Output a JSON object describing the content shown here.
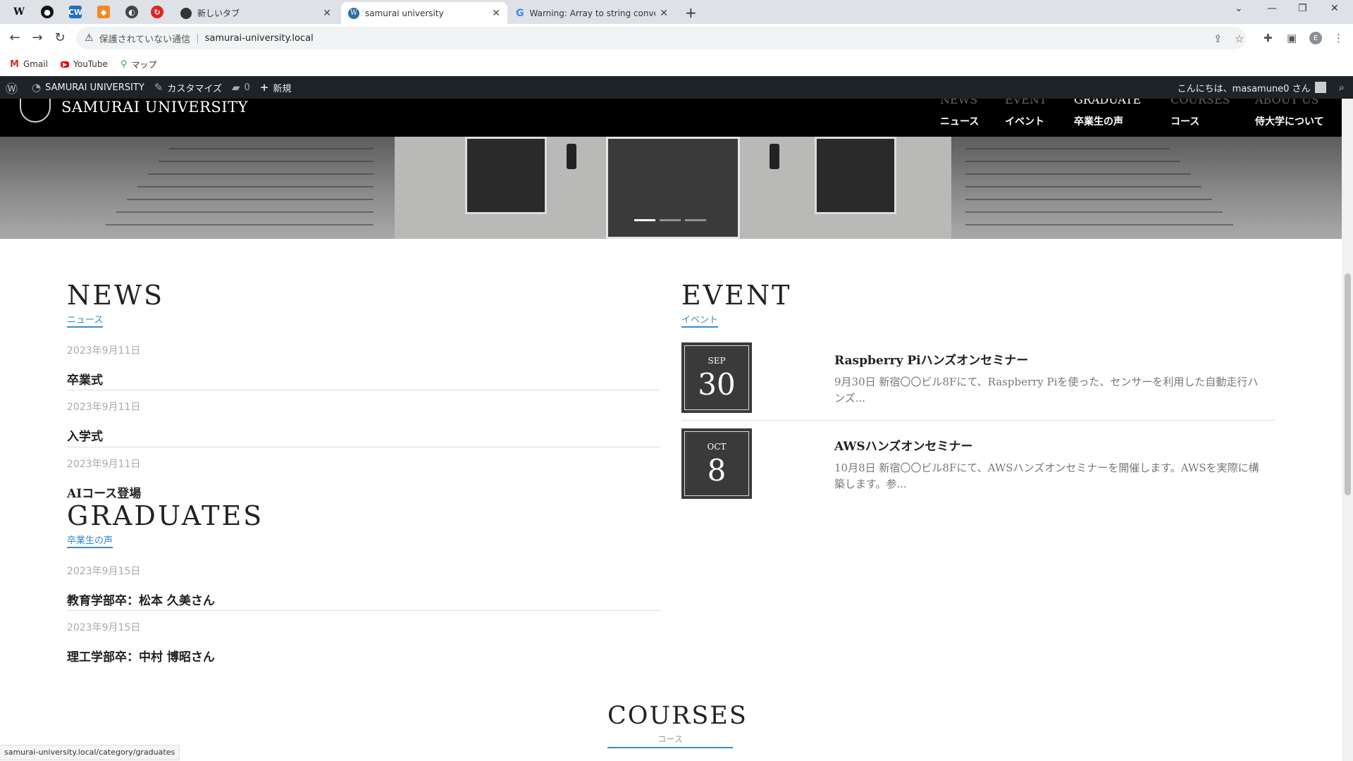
{
  "browser": {
    "tabs": [
      {
        "title": "新しいタブ",
        "icon": "github-icon"
      },
      {
        "title": "samurai university",
        "icon": "wordpress-icon"
      },
      {
        "title": "Warning: Array to string conversio",
        "icon": "google-icon"
      }
    ],
    "omnibox": {
      "security": "保護されていない通信",
      "url": "samurai-university.local"
    },
    "bookmarks": [
      {
        "label": "Gmail",
        "icon": "gmail-icon"
      },
      {
        "label": "YouTube",
        "icon": "youtube-icon"
      },
      {
        "label": "マップ",
        "icon": "maps-icon"
      }
    ],
    "profile_initial": "E",
    "status_url": "samurai-university.local/category/graduates"
  },
  "adminbar": {
    "site_name": "SAMURAI UNIVERSITY",
    "customize": "カスタマイズ",
    "comments": "0",
    "new": "新規",
    "greeting": "こんにちは、masamune0 さん"
  },
  "header": {
    "logo": "SAMURAI UNIVERSITY",
    "nav": [
      {
        "en": "NEWS",
        "ja": "ニュース"
      },
      {
        "en": "EVENT",
        "ja": "イベント"
      },
      {
        "en": "GRADUATE",
        "ja": "卒業生の声"
      },
      {
        "en": "COURSES",
        "ja": "コース"
      },
      {
        "en": "ABOUT US",
        "ja": "侍大学について"
      }
    ]
  },
  "news": {
    "title": "NEWS",
    "subtitle": "ニュース",
    "posts": [
      {
        "date": "2023年9月11日",
        "title": "卒業式"
      },
      {
        "date": "2023年9月11日",
        "title": "入学式"
      },
      {
        "date": "2023年9月11日",
        "title": "AIコース登場"
      }
    ]
  },
  "graduates": {
    "title": "GRADUATES",
    "subtitle": "卒業生の声",
    "posts": [
      {
        "date": "2023年9月15日",
        "title": "教育学部卒：松本 久美さん"
      },
      {
        "date": "2023年9月15日",
        "title": "理工学部卒：中村 博昭さん"
      }
    ]
  },
  "event": {
    "title": "EVENT",
    "subtitle": "イベント",
    "items": [
      {
        "month": "SEP",
        "day": "30",
        "title": "Raspberry Piハンズオンセミナー",
        "desc": "9月30日 新宿〇〇ビル8Fにて、Raspberry Piを使った、センサーを利用した自動走行ハンズ..."
      },
      {
        "month": "OCT",
        "day": "8",
        "title": "AWSハンズオンセミナー",
        "desc": "10月8日 新宿〇〇ビル8Fにて、AWSハンズオンセミナーを開催します。AWSを実際に構築します。参..."
      }
    ]
  },
  "courses": {
    "title": "COURSES",
    "subtitle": "コース"
  }
}
